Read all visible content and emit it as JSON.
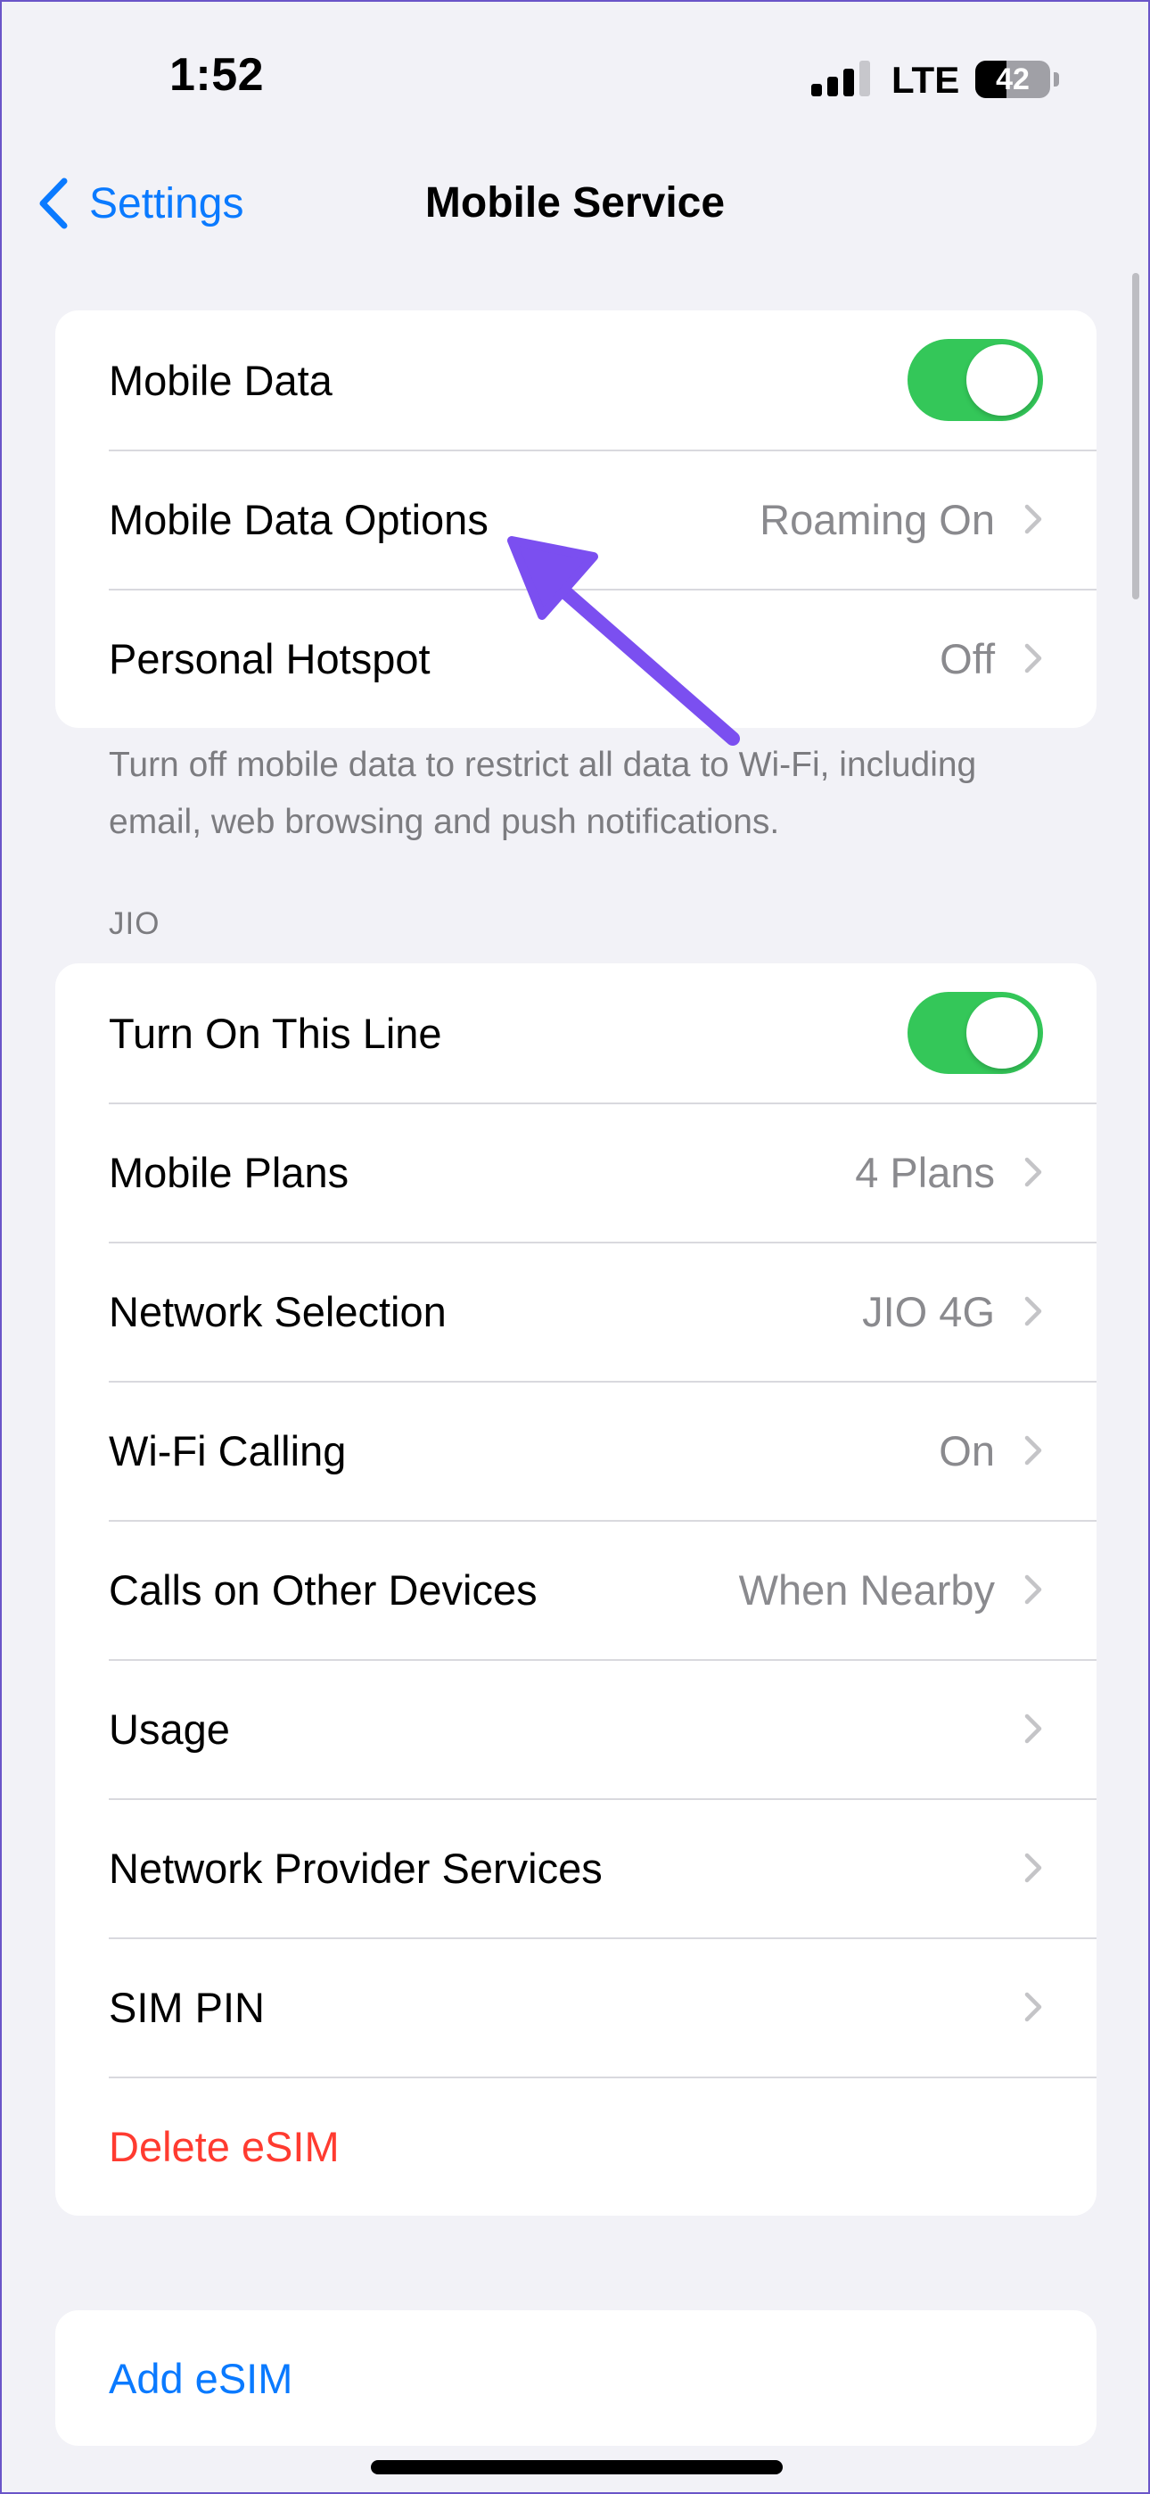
{
  "status_bar": {
    "time": "1:52",
    "network": "LTE",
    "battery": "42",
    "battery_level": 0.42
  },
  "nav": {
    "back_label": "Settings",
    "title": "Mobile Service"
  },
  "group1": {
    "mobile_data": {
      "label": "Mobile Data",
      "on": true
    },
    "mobile_data_options": {
      "label": "Mobile Data Options",
      "value": "Roaming On"
    },
    "personal_hotspot": {
      "label": "Personal Hotspot",
      "value": "Off"
    },
    "footer": "Turn off mobile data to restrict all data to Wi-Fi, including email, web browsing and push notifications."
  },
  "jio": {
    "header": "JIO",
    "turn_on_line": {
      "label": "Turn On This Line",
      "on": true
    },
    "mobile_plans": {
      "label": "Mobile Plans",
      "value": "4 Plans"
    },
    "network_selection": {
      "label": "Network Selection",
      "value": "JIO 4G"
    },
    "wifi_calling": {
      "label": "Wi-Fi Calling",
      "value": "On"
    },
    "calls_other_devices": {
      "label": "Calls on Other Devices",
      "value": "When Nearby"
    },
    "usage": {
      "label": "Usage"
    },
    "network_provider_services": {
      "label": "Network Provider Services"
    },
    "sim_pin": {
      "label": "SIM PIN"
    },
    "delete_esim": {
      "label": "Delete eSIM"
    }
  },
  "add_esim": {
    "label": "Add eSIM"
  },
  "colors": {
    "accent": "#0a7aff",
    "toggle_on": "#34c759",
    "destructive": "#ff3b30",
    "annotation_arrow": "#7b4ff0"
  }
}
